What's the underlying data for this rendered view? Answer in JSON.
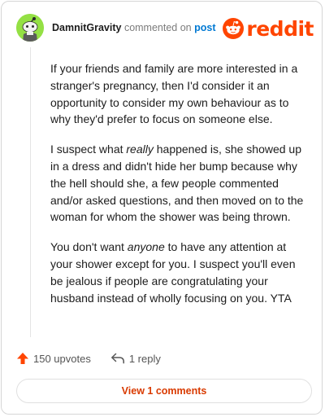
{
  "comment": {
    "username": "DamnitGravity",
    "action_text": "commented on",
    "target_link": "post",
    "paragraphs": [
      {
        "text": "If your friends and family are more interested in a stranger's pregnancy, then I'd consider it an opportunity to consider my own behaviour as to why they'd prefer to focus on someone else."
      },
      {
        "before": "I suspect what ",
        "emphasis": "really",
        "after": " happened is, she showed up in a dress and didn't hide her bump because why the hell should she, a few people commented and/or asked questions, and then moved on to the woman for whom the shower was being thrown."
      },
      {
        "before": "You don't want ",
        "emphasis": "anyone",
        "after": " to have any attention at your shower except for you. I suspect you'll even be jealous if people are congratulating your husband instead of wholly focusing on you. YTA"
      }
    ]
  },
  "brand": {
    "wordmark": "reddit",
    "color": "#ff4500"
  },
  "avatar": {
    "background": "#94e044",
    "icon": "snoo-avatar-icon"
  },
  "actions": {
    "upvotes_label": "150 upvotes",
    "reply_label": "1 reply",
    "upvote_icon": "upvote-arrow-icon",
    "reply_icon": "reply-arrow-icon",
    "upvote_color": "#ff4500"
  },
  "footer": {
    "view_comments_label": "View 1 comments",
    "accent": "#d93a00"
  }
}
